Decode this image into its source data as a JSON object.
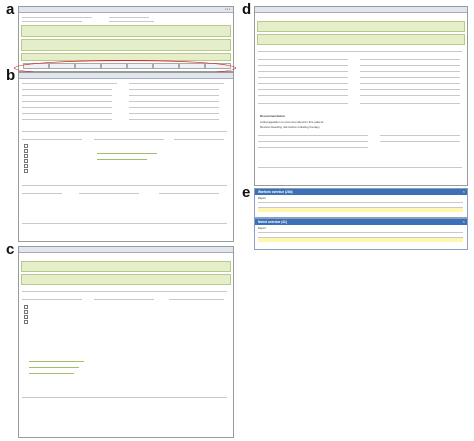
{
  "panel_labels": {
    "a": "a",
    "b": "b",
    "c": "c",
    "d": "d",
    "e": "e"
  },
  "dialog_e1": {
    "title": "Warfarin overdue (28d)",
    "close": "×",
    "section": "Report"
  },
  "dialog_e2": {
    "title": "Noted overdue (41)",
    "close": "×",
    "section": "Report"
  },
  "panel_d_notes": {
    "line1": "Recommendation",
    "line2": "Anticoagulation is recommended for this patient.",
    "line3": "Review bleeding risk before initiating therapy."
  },
  "icons": {
    "close": "close-icon",
    "checkbox": "checkbox-icon"
  },
  "colors": {
    "highlight_green": "#e4eec9",
    "ring_red": "#d22222",
    "dialog_blue": "#3b6fb6",
    "header_blue": "#dfe6ee"
  }
}
